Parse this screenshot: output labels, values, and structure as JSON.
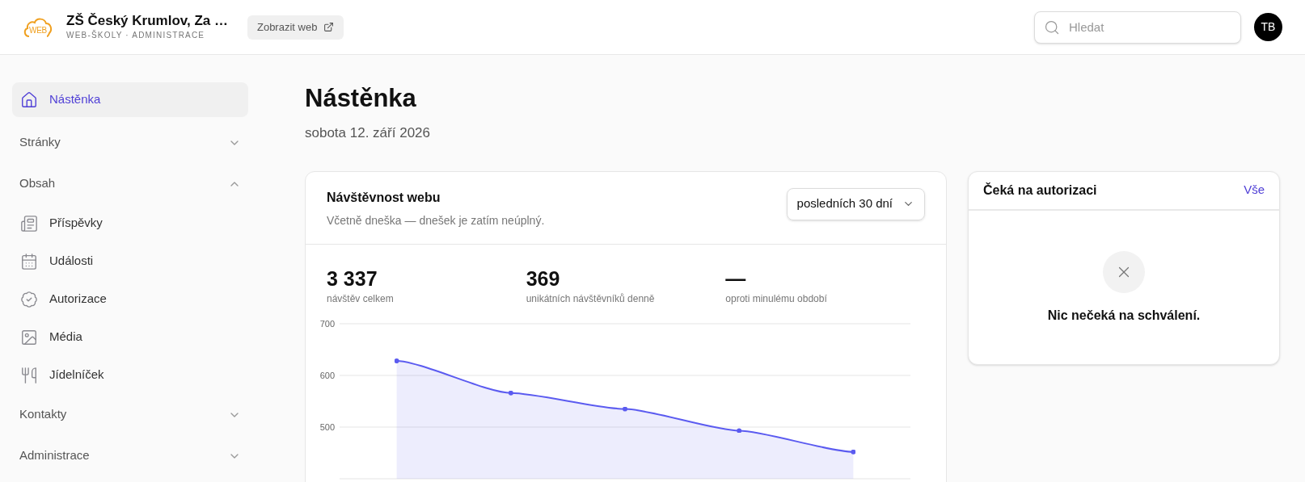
{
  "header": {
    "logo_text": "WEB",
    "site_name": "ZŠ Český Krumlov, Za …",
    "subtitle": "WEB-ŠKOLY · ADMINISTRACE",
    "view_site_button": "Zobrazit web",
    "search": {
      "placeholder": "Hledat"
    },
    "avatar": "TB"
  },
  "sidebar": {
    "items": [
      {
        "kind": "link",
        "label": "Nástěnka",
        "selected": true
      },
      {
        "kind": "group",
        "label": "Stránky",
        "expanded": false
      },
      {
        "kind": "group",
        "label": "Obsah",
        "expanded": true,
        "children": [
          {
            "label": "Příspěvky",
            "selected": false
          },
          {
            "label": "Události",
            "selected": false
          },
          {
            "label": "Autorizace",
            "selected": false
          },
          {
            "label": "Média",
            "selected": false
          },
          {
            "label": "Jídelníček",
            "selected": false
          }
        ]
      },
      {
        "kind": "group",
        "label": "Kontakty",
        "expanded": false
      },
      {
        "kind": "group",
        "label": "Administrace",
        "expanded": false
      }
    ]
  },
  "page": {
    "title": "Nástěnka",
    "date": "sobota 12. září 2026"
  },
  "traffic_card": {
    "title": "Návštěvnost webu",
    "subtitle": "Včetně dneška — dnešek je zatím neúplný.",
    "period_select": "posledních 30 dní",
    "stats": [
      {
        "value": "3 337",
        "label": "návštěv celkem"
      },
      {
        "value": "369",
        "label": "unikátních návštěvníků denně"
      },
      {
        "value": "—",
        "label": "oproti minulému období"
      }
    ],
    "chart_data": {
      "type": "area",
      "ylim": [
        400,
        700
      ],
      "yticks": [
        500,
        600,
        700
      ],
      "series": [
        {
          "color": "#5b5bf0",
          "values": [
            628,
            566,
            535,
            493,
            452
          ]
        }
      ]
    }
  },
  "approval_card": {
    "title": "Čeká na autorizaci",
    "link": "Vše",
    "empty_message": "Nic nečeká na schválení."
  }
}
